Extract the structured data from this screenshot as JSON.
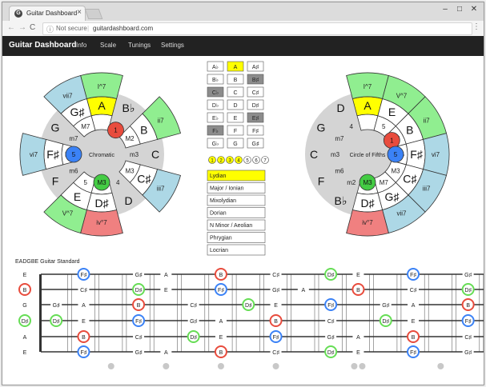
{
  "browser": {
    "tab_title": "Guitar Dashboard",
    "tab_favicon": "G",
    "close_icon": "×",
    "minimize_icon": "–",
    "maximize_icon": "□",
    "window_close_icon": "✕",
    "back_icon": "←",
    "forward_icon": "→",
    "reload_icon": "C",
    "info_icon": "ⓘ",
    "security": "Not secure",
    "separator": "|",
    "url": "guitardashboard.com",
    "menu_icon": "⋮"
  },
  "navbar": {
    "brand": "Guitar Dashboard",
    "links": [
      "Info",
      "Scale",
      "Tunings",
      "Settings"
    ]
  },
  "chromatic": {
    "center_label": "Chromatic",
    "notes": [
      "A",
      "B♭",
      "B",
      "C",
      "C♯",
      "D",
      "D♯",
      "E",
      "F",
      "F♯",
      "G",
      "G♯"
    ],
    "note_fill": [
      "#ffff00",
      "#ffffff",
      "#ffffff",
      "#ffffff",
      "#ffffff",
      "#ffffff",
      "#ffffff",
      "#ffffff",
      "#ffffff",
      "#ffffff",
      "#ffffff",
      "#ffffff"
    ],
    "note_in_scale": [
      true,
      false,
      true,
      false,
      true,
      false,
      true,
      true,
      false,
      true,
      false,
      true
    ],
    "intervals": [
      "",
      "m2",
      "M2",
      "m3",
      "M3",
      "4",
      "d5",
      "5",
      "m6",
      "M6",
      "m7",
      "M7"
    ],
    "chords": [
      {
        "label": "I^7",
        "fill": "#90ee90",
        "start": 0
      },
      {
        "label": "ii7",
        "fill": "#90ee90",
        "start": 2
      },
      {
        "label": "iii7",
        "fill": "#add8e6",
        "start": 4
      },
      {
        "label": "iv°7",
        "fill": "#f08080",
        "start": 6
      },
      {
        "label": "V^7",
        "fill": "#90ee90",
        "start": 7
      },
      {
        "label": "vi7",
        "fill": "#add8e6",
        "start": 9
      },
      {
        "label": "vii7",
        "fill": "#add8e6",
        "start": 11
      }
    ],
    "markers": [
      {
        "label": "1",
        "fill": "#e84c3d",
        "step": 1
      },
      {
        "label": "5",
        "fill": "#3b82f6",
        "step": 9
      },
      {
        "label": "M3",
        "fill": "#44cc44",
        "step": 6
      }
    ]
  },
  "fifths": {
    "center_label": "Circle of Fifths",
    "notes": [
      "A",
      "E",
      "B",
      "F♯",
      "C♯",
      "G♯",
      "D♯",
      "B♭",
      "F",
      "C",
      "G",
      "D"
    ],
    "note_fill": [
      "#ffff00",
      "#ffffff",
      "#ffffff",
      "#ffffff",
      "#ffffff",
      "#ffffff",
      "#ffffff",
      "#ffffff",
      "#ffffff",
      "#ffffff",
      "#ffffff",
      "#ffffff"
    ],
    "note_in_scale": [
      true,
      true,
      true,
      true,
      true,
      true,
      true,
      false,
      false,
      false,
      false,
      false
    ],
    "intervals": [
      "",
      "5",
      "M2",
      "M6",
      "M3",
      "M7",
      "d5",
      "m2",
      "m6",
      "m3",
      "m7",
      "4"
    ],
    "chords": [
      {
        "label": "I^7",
        "fill": "#90ee90",
        "start": 0
      },
      {
        "label": "V^7",
        "fill": "#90ee90",
        "start": 1
      },
      {
        "label": "ii7",
        "fill": "#90ee90",
        "start": 2
      },
      {
        "label": "vi7",
        "fill": "#add8e6",
        "start": 3
      },
      {
        "label": "iii7",
        "fill": "#add8e6",
        "start": 4
      },
      {
        "label": "vii7",
        "fill": "#add8e6",
        "start": 5
      },
      {
        "label": "iv°7",
        "fill": "#f08080",
        "start": 6
      }
    ],
    "markers": [
      {
        "label": "1",
        "fill": "#e84c3d",
        "step": 2
      },
      {
        "label": "5",
        "fill": "#3b82f6",
        "step": 3
      },
      {
        "label": "M3",
        "fill": "#44cc44",
        "step": 6
      }
    ]
  },
  "note_grid": {
    "rows": [
      [
        "A♭",
        "A",
        "A♯"
      ],
      [
        "B♭",
        "B",
        "B♯"
      ],
      [
        "C♭",
        "C",
        "C♯"
      ],
      [
        "D♭",
        "D",
        "D♯"
      ],
      [
        "E♭",
        "E",
        "E♯"
      ],
      [
        "F♭",
        "F",
        "F♯"
      ],
      [
        "G♭",
        "G",
        "G♯"
      ]
    ],
    "states": [
      [
        "n",
        "y",
        "n"
      ],
      [
        "n",
        "n",
        "g"
      ],
      [
        "g",
        "n",
        "n"
      ],
      [
        "n",
        "n",
        "n"
      ],
      [
        "n",
        "n",
        "g"
      ],
      [
        "g",
        "n",
        "n"
      ],
      [
        "n",
        "n",
        "n"
      ]
    ]
  },
  "degree_selector": {
    "items": [
      "1",
      "2",
      "3",
      "4",
      "5",
      "6",
      "7"
    ],
    "highlight": [
      true,
      true,
      true,
      true,
      false,
      false,
      false
    ]
  },
  "modes": {
    "items": [
      "Lydian",
      "Major / Ionian",
      "Mixolydian",
      "Dorian",
      "N Minor / Aeolian",
      "Phrygian",
      "Locrian"
    ],
    "selected": 0
  },
  "fretboard": {
    "title": "EADGBE Guitar Standard",
    "open_strings": [
      "E",
      "B",
      "G",
      "D",
      "A",
      "E"
    ],
    "open_markers": [
      {
        "string": 1,
        "label": "B",
        "color": "#e84c3d"
      },
      {
        "string": 3,
        "label": "D♯",
        "color": "#66dd55"
      }
    ],
    "chromatic": [
      "A",
      "A♯",
      "B",
      "C",
      "C♯",
      "D",
      "D♯",
      "E",
      "F",
      "F♯",
      "G",
      "G♯"
    ],
    "scale_notes": [
      "A",
      "B",
      "C♯",
      "D♯",
      "E",
      "F♯",
      "G♯"
    ],
    "color_notes": {
      "B": "#e84c3d",
      "F♯": "#3b82f6",
      "D♯": "#66dd55"
    },
    "inlay_frets": [
      3,
      5,
      7,
      9,
      12,
      12,
      15,
      17
    ]
  }
}
